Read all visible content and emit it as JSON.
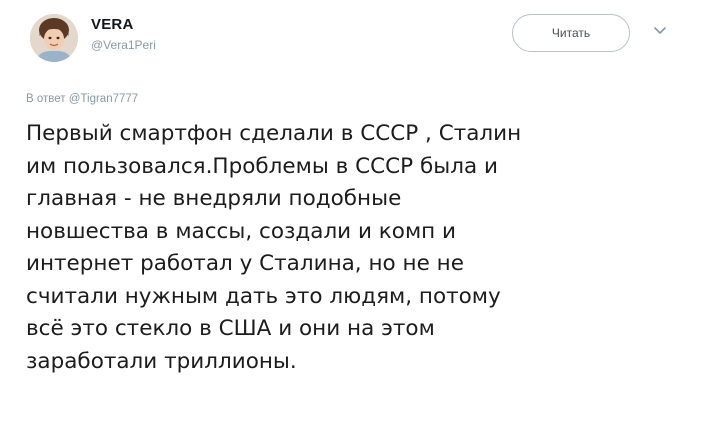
{
  "user": {
    "display_name": "VERA",
    "handle": "@Vera1Peri"
  },
  "follow_button": {
    "label": "Читать"
  },
  "icons": {
    "avatar": "avatar-photo",
    "menu": "chevron-down-icon"
  },
  "reply": {
    "prefix": "В ответ",
    "mention": "@Tigran7777"
  },
  "tweet": {
    "text": "Первый смартфон сделали в СССР , Сталин\nим пользовался.Проблемы в СССР была и\nглавная -  не внедряли подобные\nновшества в массы, создали и комп и\nинтернет работал у Сталина, но не не\nсчитали нужным дать это людям, потому\nвсё это стекло в  США и они на этом\nзаработали триллионы."
  },
  "colors": {
    "text": "#1c1c1c",
    "secondary": "#8899a6",
    "button_border": "#b9c2ca"
  }
}
